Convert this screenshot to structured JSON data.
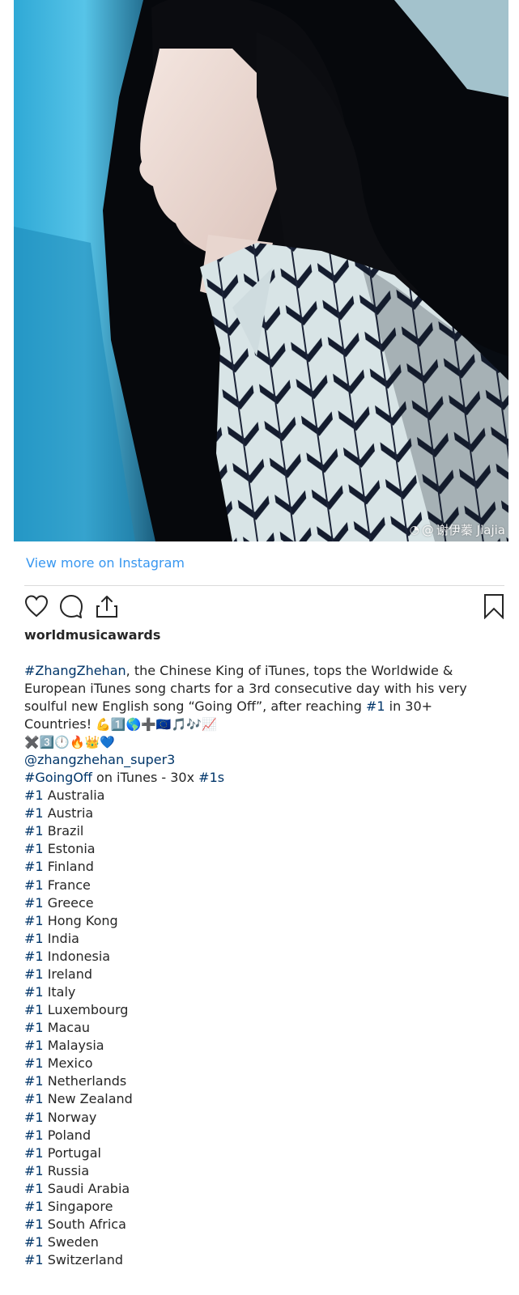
{
  "post": {
    "image_watermark_prefix": "@",
    "image_watermark_name": "谢伊蓁 Jiajia"
  },
  "view_more_label": "View more on Instagram",
  "actions": {
    "like_icon": "heart-icon",
    "comment_icon": "comment-icon",
    "share_icon": "share-icon",
    "save_icon": "bookmark-icon"
  },
  "username": "worldmusicawards",
  "caption": {
    "hashtag": "#ZhangZhehan",
    "text1": ", the Chinese King of iTunes, tops the Worldwide & European iTunes song charts for a 3rd consecutive day with his very soulful new English song “Going Off”, after reaching ",
    "hashtag2": "#1",
    "text2": " in 30+ Countries! ",
    "emojis_line1": "💪1️⃣🌎➕🇪🇺🎵🎶📈",
    "emojis_line2": "✖️3️⃣🕛🔥👑💙"
  },
  "mention": "@zhangzhehan_super3",
  "summary": {
    "hashtag": "#GoingOff",
    "text": " on iTunes - 30x ",
    "hashtag2": "#1s"
  },
  "rank_tag": "#1",
  "countries": [
    "Australia",
    "Austria",
    "Brazil",
    "Estonia",
    "Finland",
    "France",
    "Greece",
    "Hong Kong",
    "India",
    "Indonesia",
    "Ireland",
    "Italy",
    "Luxembourg",
    "Macau",
    "Malaysia",
    "Mexico",
    "Netherlands",
    "New Zealand",
    "Norway",
    "Poland",
    "Portugal",
    "Russia",
    "Saudi Arabia",
    "Singapore",
    "South Africa",
    "Sweden",
    "Switzerland"
  ],
  "colors": {
    "link_blue": "#3897f0",
    "hashtag_navy": "#003569",
    "text": "#262626",
    "divider": "#dbdbdb"
  }
}
